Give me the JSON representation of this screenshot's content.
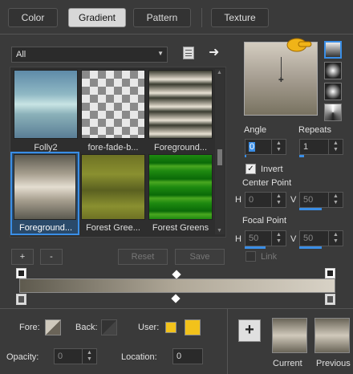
{
  "tabs": [
    {
      "label": "Color"
    },
    {
      "label": "Gradient"
    },
    {
      "label": "Pattern"
    },
    {
      "label": "Texture"
    }
  ],
  "category": {
    "value": "All"
  },
  "swatches": [
    {
      "label": "Folly2"
    },
    {
      "label": "fore-fade-b..."
    },
    {
      "label": "Foreground..."
    },
    {
      "label": "Foreground..."
    },
    {
      "label": "Forest Gree..."
    },
    {
      "label": "Forest Greens"
    }
  ],
  "buttons": {
    "add": "+",
    "remove": "-",
    "reset": "Reset",
    "save": "Save"
  },
  "angle": {
    "label": "Angle",
    "value": "0"
  },
  "repeats": {
    "label": "Repeats",
    "value": "1"
  },
  "invert": {
    "label": "Invert",
    "checked": true
  },
  "center_point": {
    "label": "Center Point",
    "h_label": "H",
    "h_value": "0",
    "v_label": "V",
    "v_value": "50"
  },
  "focal_point": {
    "label": "Focal Point",
    "h_label": "H",
    "h_value": "50",
    "v_label": "V",
    "v_value": "50"
  },
  "link": {
    "label": "Link"
  },
  "bottom": {
    "fore_label": "Fore:",
    "back_label": "Back:",
    "user_label": "User:",
    "opacity_label": "Opacity:",
    "opacity_value": "0",
    "location_label": "Location:",
    "location_value": "0",
    "current_label": "Current",
    "previous_label": "Previous",
    "add_label": "+"
  },
  "colors": {
    "accent": "#3a8ee6",
    "user_color": "#f2c21b"
  }
}
